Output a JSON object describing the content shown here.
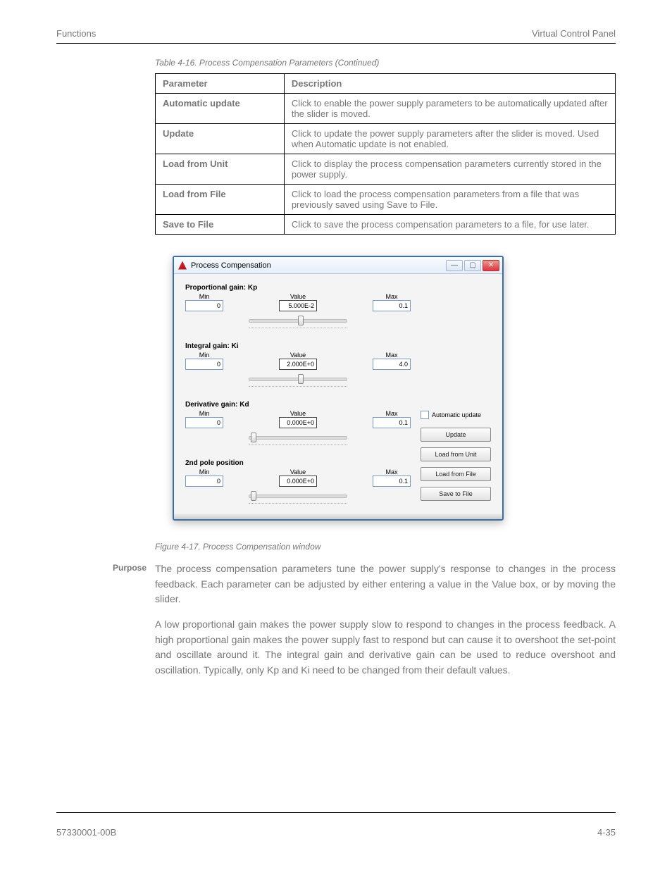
{
  "header": {
    "left": "Functions",
    "right": "Virtual Control Panel"
  },
  "tablecap": "Table 4-16. Process Compensation Parameters (Continued)",
  "table": {
    "head": [
      "Parameter",
      "Description"
    ],
    "rows": [
      [
        "Automatic update",
        "Click to enable the power supply parameters to be automatically updated after the slider is moved."
      ],
      [
        "Update",
        "Click to update the power supply parameters after the slider is moved. Used when Automatic update is not enabled."
      ],
      [
        "Load from Unit",
        "Click to display the process compensation parameters currently stored in the power supply."
      ],
      [
        "Load from File",
        "Click to load the process compensation parameters from a file that was previously saved using Save to File."
      ],
      [
        "Save to File",
        "Click to save the process compensation parameters to a file, for use later."
      ]
    ]
  },
  "dialog": {
    "title": "Process Compensation",
    "sliders": [
      {
        "label": "Proportional gain: Kp",
        "minLabel": "Min",
        "min": "0",
        "valLabel": "Value",
        "val": "5.000E-2",
        "maxLabel": "Max",
        "max": "0.1",
        "pos": 50
      },
      {
        "label": "Integral gain: Ki",
        "minLabel": "Min",
        "min": "0",
        "valLabel": "Value",
        "val": "2.000E+0",
        "maxLabel": "Max",
        "max": "4.0",
        "pos": 50
      },
      {
        "label": "Derivative gain: Kd",
        "minLabel": "Min",
        "min": "0",
        "valLabel": "Value",
        "val": "0.000E+0",
        "maxLabel": "Max",
        "max": "0.1",
        "pos": 2
      },
      {
        "label": "2nd pole position",
        "minLabel": "Min",
        "min": "0",
        "valLabel": "Value",
        "val": "0.000E+0",
        "maxLabel": "Max",
        "max": "0.1",
        "pos": 2
      }
    ],
    "auto": "Automatic update",
    "buttons": [
      "Update",
      "Load from Unit",
      "Load from File",
      "Save to File"
    ]
  },
  "figcap": "Figure 4-17. Process Compensation window",
  "purposeLabel": "Purpose",
  "para1": "The process compensation parameters tune the power supply's response to changes in the process feedback. Each parameter can be adjusted by either entering a value in the Value box, or by moving the slider.",
  "para2": "A low proportional gain makes the power supply slow to respond to changes in the process feedback. A high proportional gain makes the power supply fast to respond but can cause it to overshoot the set-point and oscillate around it. The integral gain and derivative gain can be used to reduce overshoot and oscillation. Typically, only Kp and Ki need to be changed from their default values.",
  "footer": {
    "left": "57330001-00B",
    "right": "4-35"
  }
}
